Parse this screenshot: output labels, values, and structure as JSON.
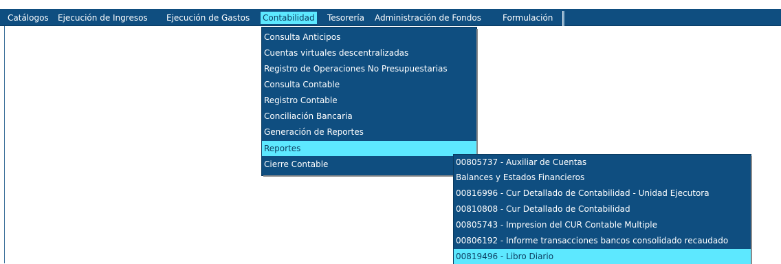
{
  "menubar": {
    "items": [
      {
        "label": "Catálogos"
      },
      {
        "label": "Ejecución de Ingresos"
      },
      {
        "label": "Ejecución de Gastos"
      },
      {
        "label": "Contabilidad"
      },
      {
        "label": "Tesorería"
      },
      {
        "label": "Administración de Fondos"
      },
      {
        "label": "Formulación"
      }
    ],
    "active": "Contabilidad"
  },
  "contabilidad_menu": {
    "items": [
      {
        "label": "Consulta Anticipos"
      },
      {
        "label": "Cuentas virtuales descentralizadas"
      },
      {
        "label": "Registro de Operaciones No Presupuestarias"
      },
      {
        "label": "Consulta Contable"
      },
      {
        "label": "Registro Contable"
      },
      {
        "label": "Conciliación Bancaria"
      },
      {
        "label": "Generación de Reportes"
      },
      {
        "label": "Reportes"
      },
      {
        "label": "Cierre Contable"
      }
    ],
    "highlighted": "Reportes"
  },
  "reportes_submenu": {
    "items": [
      {
        "label": "00805737 - Auxiliar de Cuentas"
      },
      {
        "label": "Balances y Estados Financieros"
      },
      {
        "label": "00816996 - Cur Detallado de Contabilidad - Unidad Ejecutora"
      },
      {
        "label": "00810808 - Cur Detallado de Contabilidad"
      },
      {
        "label": "00805743 - Impresion del CUR Contable Multiple"
      },
      {
        "label": "00806192 - Informe transacciones bancos consolidado recaudado"
      },
      {
        "label": "00819496 - Libro Diario"
      }
    ],
    "highlighted": "00819496 - Libro Diario"
  },
  "colors": {
    "menu_bg": "#0f4e80",
    "highlight_bg": "#5de8ff",
    "menu_text": "#ffffff",
    "page_bg": "#ffffff"
  }
}
